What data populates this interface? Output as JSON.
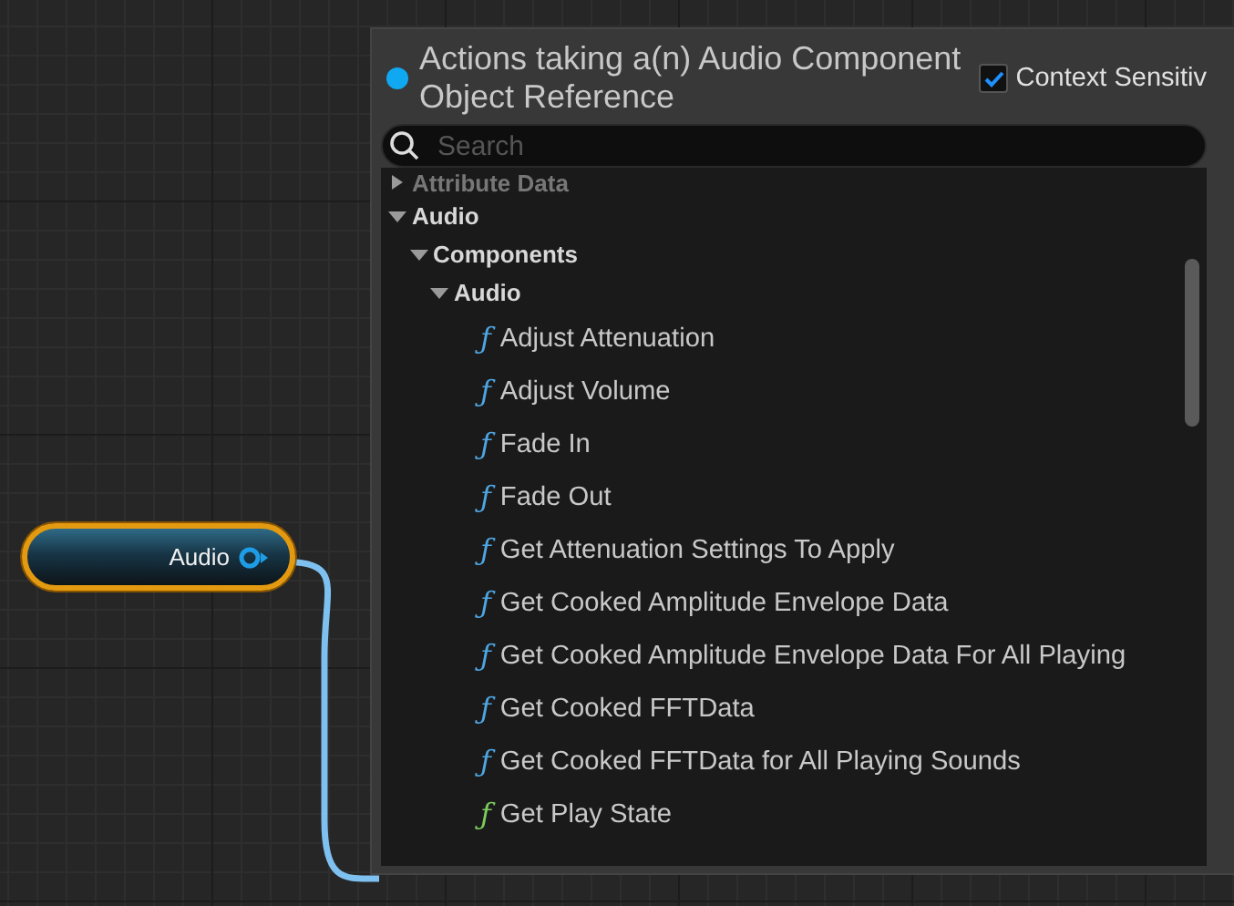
{
  "node": {
    "label": "Audio"
  },
  "menu": {
    "title": "Actions taking a(n) Audio Component Object Reference",
    "context_sensitive": {
      "label": "Context Sensitiv",
      "checked": true
    },
    "search": {
      "placeholder": "Search"
    },
    "tree": [
      {
        "kind": "category",
        "label": "Attribute Data",
        "expanded": false
      },
      {
        "kind": "category",
        "label": "Audio",
        "expanded": true,
        "children": [
          {
            "kind": "category",
            "label": "Components",
            "expanded": true,
            "children": [
              {
                "kind": "category",
                "label": "Audio",
                "expanded": true,
                "children": [
                  {
                    "kind": "function",
                    "label": "Adjust Attenuation",
                    "icon": "ƒ",
                    "color": "#4ea6e2"
                  },
                  {
                    "kind": "function",
                    "label": "Adjust Volume",
                    "icon": "ƒ",
                    "color": "#4ea6e2"
                  },
                  {
                    "kind": "function",
                    "label": "Fade In",
                    "icon": "ƒ",
                    "color": "#4ea6e2"
                  },
                  {
                    "kind": "function",
                    "label": "Fade Out",
                    "icon": "ƒ",
                    "color": "#4ea6e2"
                  },
                  {
                    "kind": "function",
                    "label": "Get Attenuation Settings To Apply",
                    "icon": "ƒ",
                    "color": "#4ea6e2"
                  },
                  {
                    "kind": "function",
                    "label": "Get Cooked Amplitude Envelope Data",
                    "icon": "ƒ",
                    "color": "#4ea6e2"
                  },
                  {
                    "kind": "function",
                    "label": "Get Cooked Amplitude Envelope Data For All Playing",
                    "icon": "ƒ",
                    "color": "#4ea6e2"
                  },
                  {
                    "kind": "function",
                    "label": "Get Cooked FFTData",
                    "icon": "ƒ",
                    "color": "#4ea6e2"
                  },
                  {
                    "kind": "function",
                    "label": "Get Cooked FFTData for All Playing Sounds",
                    "icon": "ƒ",
                    "color": "#4ea6e2"
                  },
                  {
                    "kind": "function",
                    "label": "Get Play State",
                    "icon": "ƒ",
                    "color": "#7ccb5e"
                  }
                ]
              }
            ]
          }
        ]
      }
    ]
  }
}
